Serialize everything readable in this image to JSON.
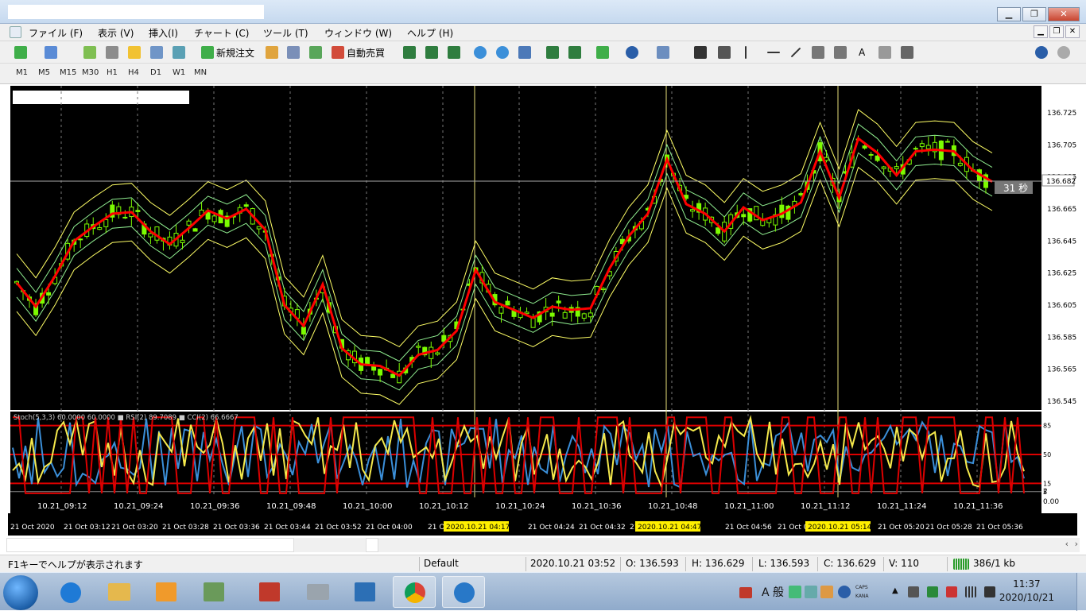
{
  "window": {
    "controls": {
      "minimize": "▁",
      "maximize": "❐",
      "close": "✕"
    }
  },
  "menu": {
    "items": [
      "ファイル (F)",
      "表示 (V)",
      "挿入(I)",
      "チャート (C)",
      "ツール (T)",
      "ウィンドウ (W)",
      "ヘルプ (H)"
    ]
  },
  "toolbar": {
    "new_order": "新規注文",
    "auto_trading": "自動売買",
    "text_tool": "A"
  },
  "timeframes": [
    "M1",
    "M5",
    "M15",
    "M30",
    "H1",
    "H4",
    "D1",
    "W1",
    "MN"
  ],
  "chart": {
    "price_labels": [
      "136.725",
      "136.705",
      "136.685",
      "136.665",
      "136.645",
      "136.625",
      "136.605",
      "136.585",
      "136.565",
      "136.545"
    ],
    "current_price": "136.682",
    "countdown": "31 秒",
    "indicator_label": "Stoch(5,3,3) 60.0000 60.0000 ■ RSI(2) 89.7089 ■ CCI(2) 66.6667",
    "indicator_levels": [
      "85",
      "50",
      "15",
      "5"
    ],
    "session_labels": [
      "10.21_09:12",
      "10.21_09:24",
      "10.21_09:36",
      "10.21_09:48",
      "10.21_10:00",
      "10.21_10:12",
      "10.21_10:24",
      "10.21_10:36",
      "10.21_10:48",
      "10.21_11:00",
      "10.21_11:12",
      "10.21_11:24",
      "10.21_11:36"
    ],
    "time_labels": [
      "21 Oct 2020",
      "21 Oct 03:12",
      "21 Oct 03:20",
      "21 Oct 03:28",
      "21 Oct 03:36",
      "21 Oct 03:44",
      "21 Oct 03:52",
      "21 Oct 04:00",
      "21 Oct",
      "21 Oct 04:24",
      "21 Oct 04:32",
      "21 Oct",
      "04:48",
      "21 Oct 04:56",
      "21 Oct 05",
      "21 Oct 05:20",
      "21 Oct 05:28",
      "21 Oct 05:36"
    ],
    "highlight_labels": [
      "2020.10.21 04:17",
      "2020.10.21 04:47",
      "2020.10.21 05:14"
    ],
    "subwindow_scale": [
      "2",
      "0.00"
    ]
  },
  "chart_data": {
    "type": "line",
    "title": "",
    "ylim": [
      136.545,
      136.725
    ],
    "series": [
      {
        "name": "",
        "values": [
          136.619,
          136.604,
          136.623,
          136.645,
          136.654,
          136.662,
          136.663,
          136.651,
          136.643,
          136.653,
          136.664,
          136.659,
          136.665,
          136.652,
          136.605,
          136.592,
          136.618,
          136.578,
          136.568,
          136.567,
          136.561,
          136.574,
          136.577,
          136.589,
          136.627,
          136.607,
          136.602,
          136.597,
          136.604,
          136.602,
          136.603,
          136.628,
          136.648,
          136.662,
          136.696,
          136.668,
          136.662,
          136.651,
          136.666,
          136.658,
          136.662,
          136.669,
          136.701,
          136.672,
          136.709,
          136.7,
          136.686,
          136.701,
          136.702,
          136.701,
          136.689,
          136.682
        ]
      }
    ]
  },
  "status": {
    "help": "F1キーでヘルプが表示されます",
    "profile": "Default",
    "datetime": "2020.10.21 03:52",
    "open": "O: 136.593",
    "high": "H: 136.629",
    "low": "L: 136.593",
    "close": "C: 136.629",
    "volume": "V: 110",
    "traffic": "386/1 kb"
  },
  "taskbar": {
    "ime": "A 般",
    "caps": "CAPS",
    "kana": "KANA",
    "time": "11:37",
    "date": "2020/10/21"
  },
  "colors": {
    "candle": "#7cfc00",
    "ma_red": "#ff0000",
    "band_yellow": "#ffff66",
    "band_green": "#90ee90",
    "stoch_blue": "#3b8fd9"
  }
}
